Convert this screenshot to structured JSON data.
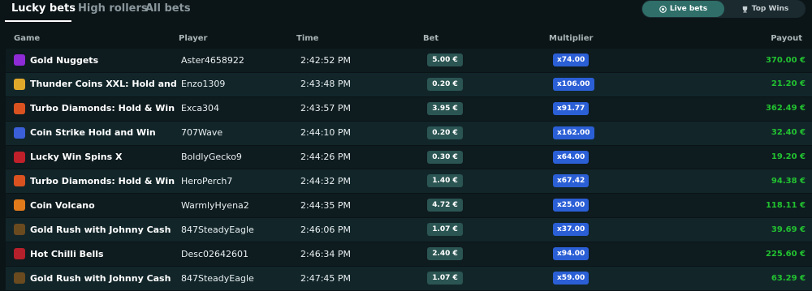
{
  "tabs": [
    {
      "label": "Lucky bets"
    },
    {
      "label": "High rollers"
    },
    {
      "label": "All bets"
    }
  ],
  "toggle": {
    "live_label": "Live bets",
    "top_label": "Top Wins"
  },
  "columns": {
    "game": "Game",
    "player": "Player",
    "time": "Time",
    "bet": "Bet",
    "multiplier": "Multiplier",
    "payout": "Payout"
  },
  "colors": {
    "payout": "#22c230",
    "bet_bg": "#2b5552",
    "multiplier_bg": "#2b5fd6"
  },
  "rows": [
    {
      "game": "Gold Nuggets",
      "player": "Aster4658922",
      "time": "2:42:52 PM",
      "bet": "5.00 €",
      "multiplier": "x74.00",
      "payout": "370.00 €",
      "icon": "gold-nuggets-icon",
      "icon_color": "#8e2bd6"
    },
    {
      "game": "Thunder Coins XXL: Hold and Win",
      "player": "Enzo1309",
      "time": "2:43:48 PM",
      "bet": "0.20 €",
      "multiplier": "x106.00",
      "payout": "21.20 €",
      "icon": "thunder-coins-icon",
      "icon_color": "#e0a82a"
    },
    {
      "game": "Turbo Diamonds: Hold & Win",
      "player": "Exca304",
      "time": "2:43:57 PM",
      "bet": "3.95 €",
      "multiplier": "x91.77",
      "payout": "362.49 €",
      "icon": "turbo-diamonds-icon",
      "icon_color": "#d9521f"
    },
    {
      "game": "Coin Strike Hold and Win",
      "player": "707Wave",
      "time": "2:44:10 PM",
      "bet": "0.20 €",
      "multiplier": "x162.00",
      "payout": "32.40 €",
      "icon": "coin-strike-icon",
      "icon_color": "#3a5fd8"
    },
    {
      "game": "Lucky Win Spins X",
      "player": "BoldlyGecko9",
      "time": "2:44:26 PM",
      "bet": "0.30 €",
      "multiplier": "x64.00",
      "payout": "19.20 €",
      "icon": "lucky-win-icon",
      "icon_color": "#c0202a"
    },
    {
      "game": "Turbo Diamonds: Hold & Win",
      "player": "HeroPerch7",
      "time": "2:44:32 PM",
      "bet": "1.40 €",
      "multiplier": "x67.42",
      "payout": "94.38 €",
      "icon": "turbo-diamonds-icon",
      "icon_color": "#d9521f"
    },
    {
      "game": "Coin Volcano",
      "player": "WarmlyHyena2",
      "time": "2:44:35 PM",
      "bet": "4.72 €",
      "multiplier": "x25.00",
      "payout": "118.11 €",
      "icon": "coin-volcano-icon",
      "icon_color": "#e07a1a"
    },
    {
      "game": "Gold Rush with Johnny Cash",
      "player": "847SteadyEagle",
      "time": "2:46:06 PM",
      "bet": "1.07 €",
      "multiplier": "x37.00",
      "payout": "39.69 €",
      "icon": "gold-rush-icon",
      "icon_color": "#6a4a1f"
    },
    {
      "game": "Hot Chilli Bells",
      "player": "Desc02642601",
      "time": "2:46:34 PM",
      "bet": "2.40 €",
      "multiplier": "x94.00",
      "payout": "225.60 €",
      "icon": "hot-chilli-icon",
      "icon_color": "#b5202a"
    },
    {
      "game": "Gold Rush with Johnny Cash",
      "player": "847SteadyEagle",
      "time": "2:47:45 PM",
      "bet": "1.07 €",
      "multiplier": "x59.00",
      "payout": "63.29 €",
      "icon": "gold-rush-icon",
      "icon_color": "#6a4a1f"
    }
  ]
}
